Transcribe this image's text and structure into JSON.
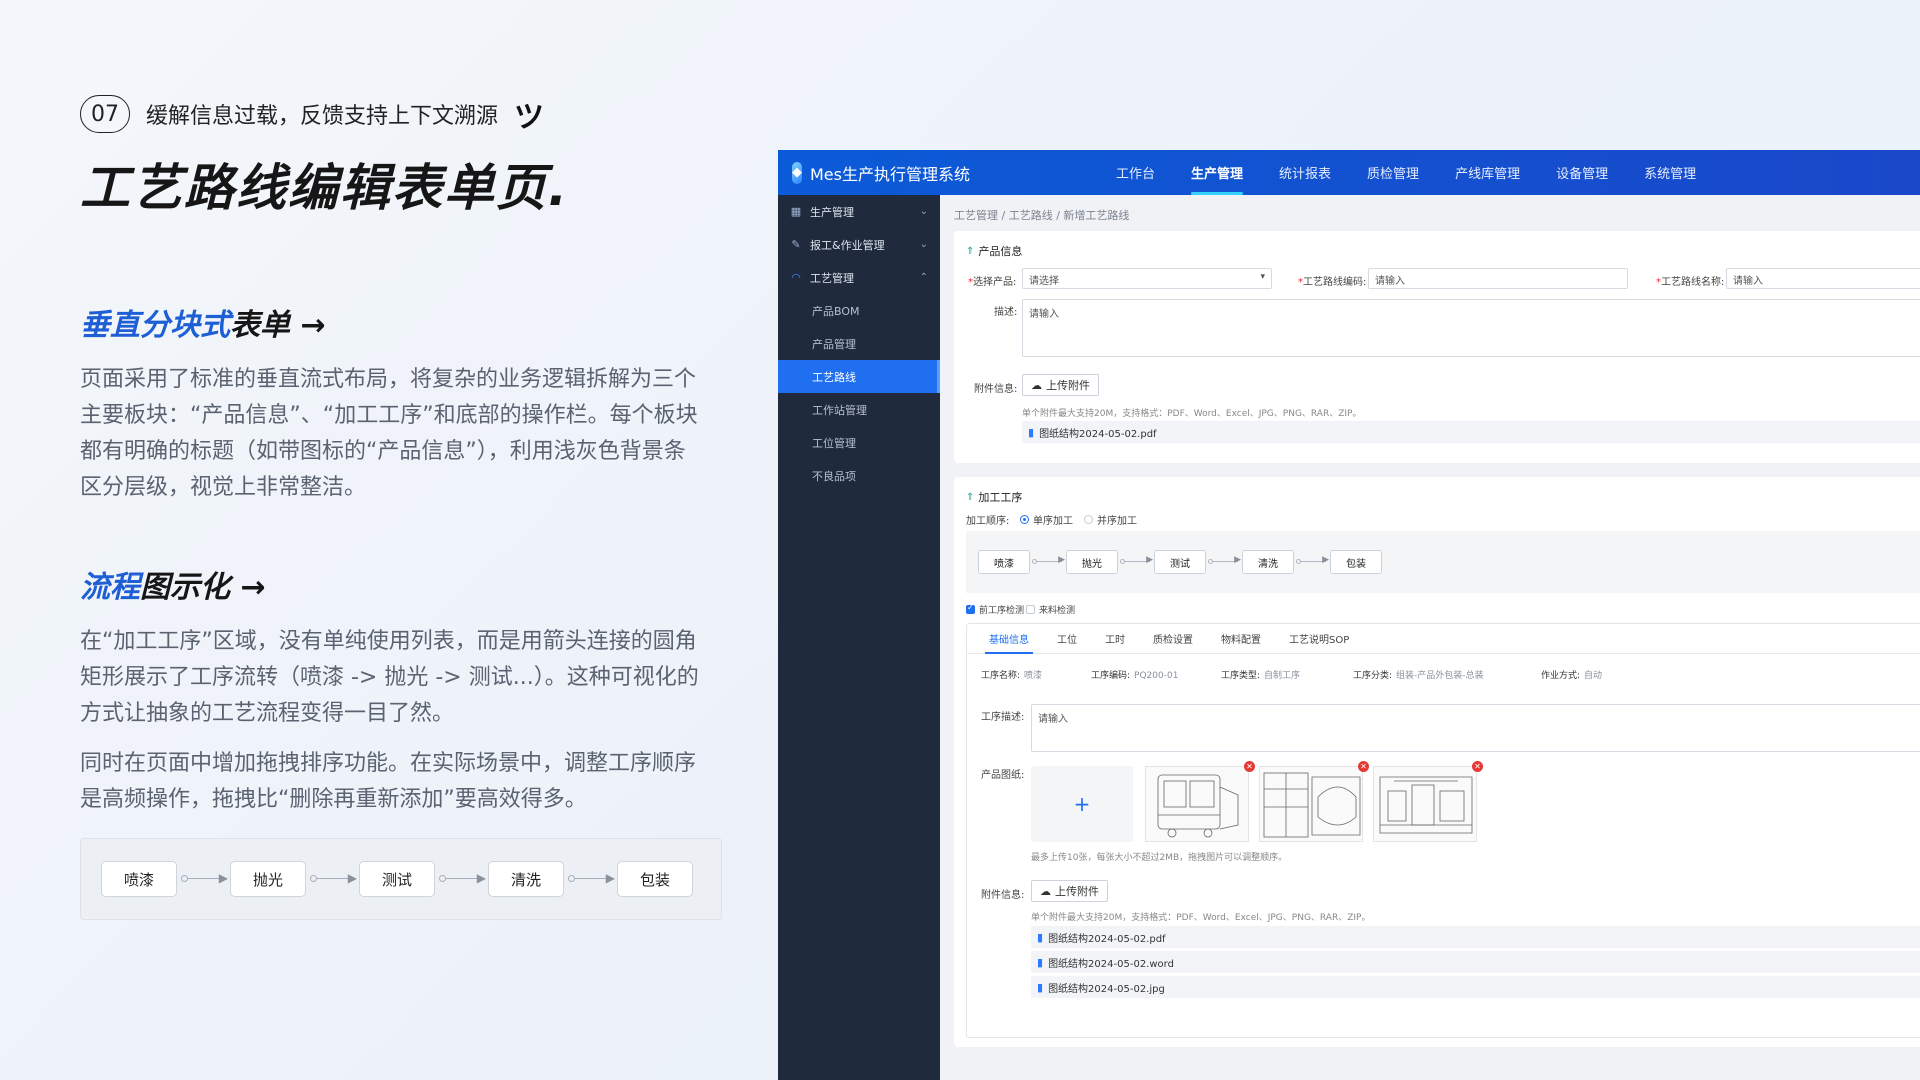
{
  "intro": {
    "step_number": "07",
    "step_caption": "缓解信息过载，反馈支持上下文溯源",
    "step_icon": "emoji-icon",
    "main_title": "工艺路线编辑表单页.",
    "section1": {
      "title_highlight": "垂直分块式",
      "title_rest": "表单 →",
      "body": "页面采用了标准的垂直流式布局，将复杂的业务逻辑拆解为三个主要板块：“产品信息”、“加工工序”和底部的操作栏。每个板块都有明确的标题（如带图标的“产品信息”），利用浅灰色背景条区分层级，视觉上非常整洁。"
    },
    "section2": {
      "title_highlight": "流程",
      "title_rest": "图示化 →",
      "body1": "在“加工工序”区域，没有单纯使用列表，而是用箭头连接的圆角矩形展示了工序流转（喷漆 -> 抛光 -> 测试...）。这种可视化的方式让抽象的工艺流程变得一目了然。",
      "body2": "同时在页面中增加拖拽排序功能。在实际场景中，调整工序顺序是高频操作，拖拽比“删除再重新添加”要高效得多。"
    },
    "flow_demo": [
      "喷漆",
      "抛光",
      "测试",
      "清洗",
      "包装"
    ]
  },
  "app": {
    "brand": "Mes生产执行管理系统",
    "nav": [
      "工作台",
      "生产管理",
      "统计报表",
      "质检管理",
      "产线库管理",
      "设备管理",
      "系统管理"
    ],
    "nav_active": "生产管理",
    "sidebar": [
      {
        "label": "生产管理",
        "icon": "grid-icon",
        "chevron": "⌄"
      },
      {
        "label": "报工&作业管理",
        "icon": "pen-icon",
        "chevron": "⌄"
      },
      {
        "label": "工艺管理",
        "icon": "wifi-icon",
        "chevron": "⌃"
      }
    ],
    "sidebar_sub": [
      "产品BOM",
      "产品管理",
      "工艺路线",
      "工作站管理",
      "工位管理",
      "不良品项"
    ],
    "sidebar_sub_active": "工艺路线",
    "breadcrumb": "工艺管理 / 工艺路线 / 新增工艺路线",
    "product": {
      "title": "产品信息",
      "select_label": "选择产品:",
      "select_placeholder": "请选择",
      "code_label": "工艺路线编码:",
      "code_placeholder": "请输入",
      "name_label": "工艺路线名称:",
      "name_placeholder": "请输入",
      "desc_label": "描述:",
      "desc_placeholder": "请输入",
      "attach_label": "附件信息:",
      "upload_label": "上传附件",
      "hint": "单个附件最大支持20M，支持格式：PDF、Word、Excel、JPG、PNG、RAR、ZIP。",
      "file": "图纸结构2024-05-02.pdf"
    },
    "process": {
      "title": "加工工序",
      "order_label": "加工顺序:",
      "radio_single": "单序加工",
      "radio_parallel": "并序加工",
      "flow": [
        "喷漆",
        "抛光",
        "测试",
        "清洗",
        "包装"
      ],
      "check_pre": "前工序检测",
      "check_incoming": "来料检测",
      "tabs": [
        "基础信息",
        "工位",
        "工时",
        "质检设置",
        "物料配置",
        "工艺说明SOP"
      ],
      "tab_active": "基础信息",
      "fields": [
        {
          "k": "工序名称:",
          "v": "喷漆"
        },
        {
          "k": "工序编码:",
          "v": "PQ200-01"
        },
        {
          "k": "工序类型:",
          "v": "自制工序"
        },
        {
          "k": "工序分类:",
          "v": "组装-产品外包装-总装"
        },
        {
          "k": "作业方式:",
          "v": "自动"
        }
      ],
      "desc_label": "工序描述:",
      "desc_placeholder": "请输入",
      "drawing_label": "产品图纸:",
      "add_symbol": "+",
      "drawing_hint": "最多上传10张，每张大小不超过2MB，拖拽图片可以调整顺序。",
      "attach_label": "附件信息:",
      "upload_label": "上传附件",
      "hint": "单个附件最大支持20M，支持格式：PDF、Word、Excel、JPG、PNG、RAR、ZIP。",
      "files": [
        "图纸结构2024-05-02.pdf",
        "图纸结构2024-05-02.word",
        "图纸结构2024-05-02.jpg"
      ]
    }
  }
}
